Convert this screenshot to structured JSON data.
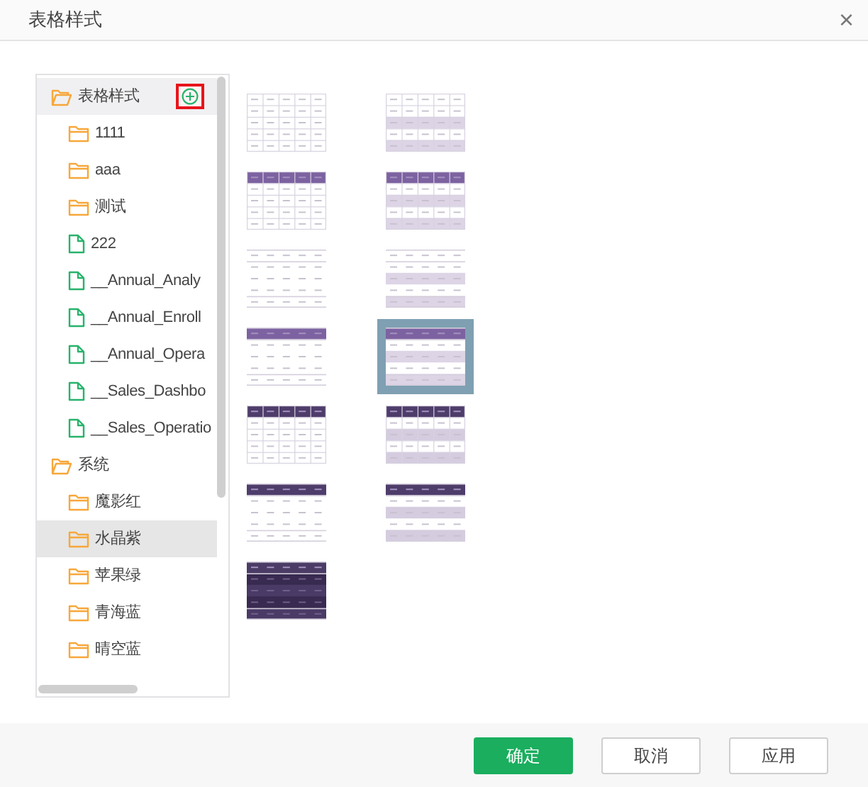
{
  "dialog": {
    "title": "表格样式",
    "close": "×"
  },
  "tree": [
    {
      "label": "表格样式",
      "kind": "folder",
      "expanded": true,
      "selected": false,
      "hovered": true,
      "add_button_highlighted": true,
      "children": [
        {
          "label": "1111",
          "kind": "folder",
          "selected": false
        },
        {
          "label": "aaa",
          "kind": "folder",
          "selected": false
        },
        {
          "label": "测试",
          "kind": "folder",
          "selected": false
        },
        {
          "label": "222",
          "kind": "file",
          "selected": false
        },
        {
          "label": "__Annual_Analy",
          "kind": "file",
          "selected": false
        },
        {
          "label": "__Annual_Enroll",
          "kind": "file",
          "selected": false
        },
        {
          "label": "__Annual_Opera",
          "kind": "file",
          "selected": false
        },
        {
          "label": "__Sales_Dashbo",
          "kind": "file",
          "selected": false
        },
        {
          "label": "__Sales_Operatio",
          "kind": "file",
          "selected": false
        }
      ]
    },
    {
      "label": "系统",
      "kind": "folder",
      "expanded": true,
      "selected": false,
      "hovered": false,
      "children": [
        {
          "label": "魔影红",
          "kind": "folder",
          "selected": false
        },
        {
          "label": "水晶紫",
          "kind": "folder",
          "selected": true
        },
        {
          "label": "苹果绿",
          "kind": "folder",
          "selected": false
        },
        {
          "label": "青海蓝",
          "kind": "folder",
          "selected": false
        },
        {
          "label": "晴空蓝",
          "kind": "folder",
          "selected": false
        }
      ]
    }
  ],
  "styles": [
    {
      "kind": "plain",
      "banded": false,
      "grid": true,
      "selected": false
    },
    {
      "kind": "plain",
      "banded": true,
      "grid": true,
      "selected": false
    },
    {
      "kind": "purple",
      "banded": false,
      "grid": true,
      "selected": false
    },
    {
      "kind": "purple",
      "banded": true,
      "grid": true,
      "selected": false
    },
    {
      "kind": "plain",
      "banded": false,
      "grid": false,
      "selected": false
    },
    {
      "kind": "plain",
      "banded": true,
      "grid": false,
      "selected": false
    },
    {
      "kind": "purple",
      "banded": false,
      "grid": false,
      "selected": false
    },
    {
      "kind": "purple",
      "banded": true,
      "grid": false,
      "selected": true
    },
    {
      "kind": "dark",
      "banded": false,
      "grid": true,
      "selected": false
    },
    {
      "kind": "dark",
      "banded": true,
      "grid": true,
      "selected": false
    },
    {
      "kind": "dark",
      "banded": false,
      "grid": false,
      "selected": false
    },
    {
      "kind": "dark",
      "banded": true,
      "grid": false,
      "selected": false
    },
    {
      "kind": "night",
      "banded": true,
      "grid": false,
      "selected": false
    }
  ],
  "buttons": [
    {
      "label": "确定",
      "kind": "primary"
    },
    {
      "label": "取消",
      "kind": "default"
    },
    {
      "label": "应用",
      "kind": "default"
    }
  ]
}
